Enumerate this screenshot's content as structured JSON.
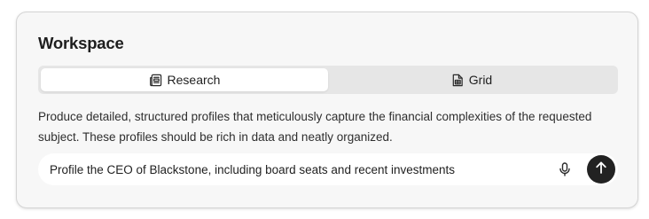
{
  "workspace": {
    "title": "Workspace",
    "tabs": [
      {
        "label": "Research",
        "icon": "newspaper-icon",
        "selected": true
      },
      {
        "label": "Grid",
        "icon": "spreadsheet-file-icon",
        "selected": false
      }
    ],
    "description": "Produce detailed, structured profiles that meticulously capture the financial complexities of the requested subject. These profiles should be rich in data and neatly organized.",
    "prompt": {
      "value": "Profile the CEO of Blackstone, including board seats and recent investments",
      "mic_icon": "microphone-icon",
      "send_icon": "arrow-up-icon"
    },
    "colors": {
      "card_bg": "#f7f7f7",
      "tab_track": "#e6e6e6",
      "send_button": "#222222"
    }
  }
}
